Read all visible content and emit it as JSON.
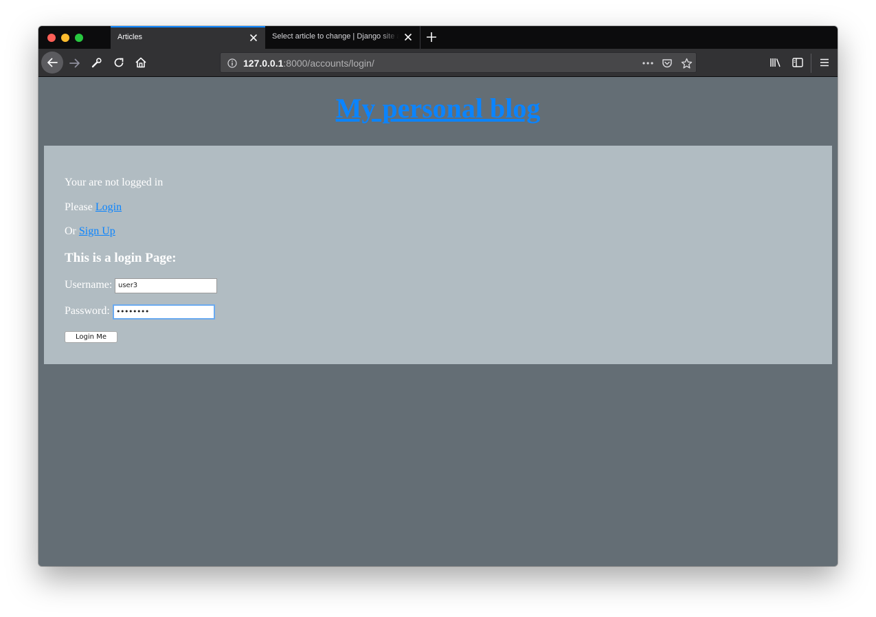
{
  "browser": {
    "tabs": [
      {
        "title": "Articles",
        "active": true
      },
      {
        "title": "Select article to change | Django site admin",
        "active": false
      }
    ],
    "url": {
      "host": "127.0.0.1",
      "rest": ":8000/accounts/login/"
    },
    "colors": {
      "tab_active_accent": "#0a84ff",
      "chrome_dark": "#0c0c0d",
      "toolbar": "#323234"
    }
  },
  "page": {
    "title": "My personal blog",
    "status": "Your are not logged in",
    "please_prefix": "Please",
    "login_link": "Login",
    "or_prefix": "Or",
    "signup_link": "Sign Up",
    "login_heading": "This is a login Page:",
    "username_label": "Username:",
    "username_value": "user3",
    "password_label": "Password:",
    "password_value": "••••••••",
    "submit_label": "Login Me",
    "colors": {
      "background": "#646e75",
      "panel": "#b1bcc2",
      "link": "#0a84ff"
    }
  }
}
